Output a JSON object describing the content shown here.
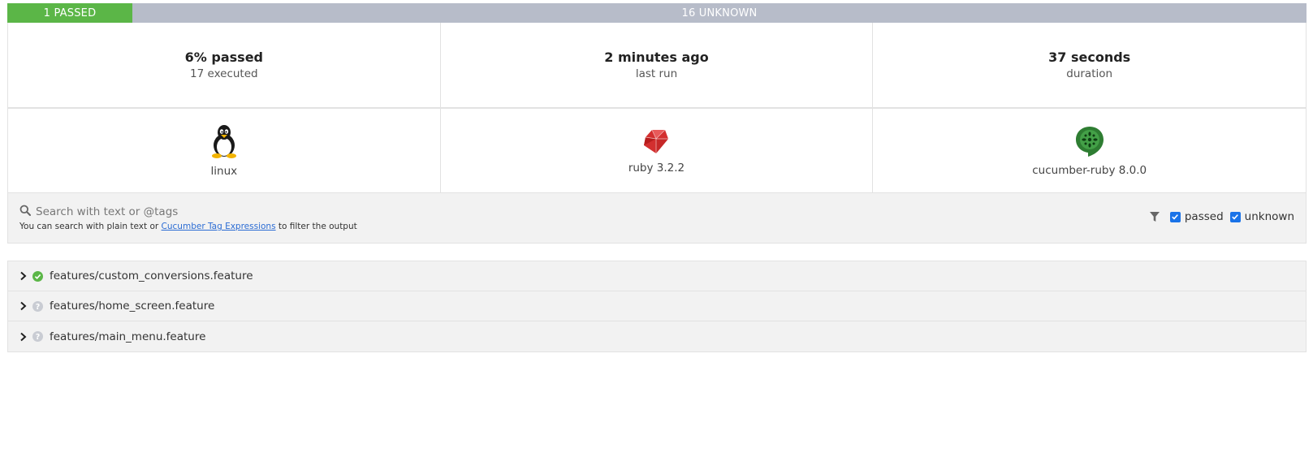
{
  "status_bar": {
    "passed_label": "1 PASSED",
    "unknown_label": "16 UNKNOWN",
    "passed_color": "#5bb647",
    "unknown_color": "#b7bcc9",
    "passed_fraction": 0.0588
  },
  "stats": [
    {
      "value": "6% passed",
      "label": "17 executed"
    },
    {
      "value": "2 minutes ago",
      "label": "last run"
    },
    {
      "value": "37 seconds",
      "label": "duration"
    }
  ],
  "environment": [
    {
      "icon": "linux-tux-icon",
      "label": "linux"
    },
    {
      "icon": "ruby-gem-icon",
      "label": "ruby 3.2.2"
    },
    {
      "icon": "cucumber-icon",
      "label": "cucumber-ruby 8.0.0"
    }
  ],
  "search": {
    "placeholder": "Search with text or @tags",
    "help_before": "You can search with plain text or ",
    "help_link": "Cucumber Tag Expressions",
    "help_after": " to filter the output"
  },
  "filters": [
    {
      "label": "passed",
      "checked": true
    },
    {
      "label": "unknown",
      "checked": true
    }
  ],
  "features": [
    {
      "name": "features/custom_conversions.feature",
      "status": "passed",
      "status_icon": "check-circle-icon"
    },
    {
      "name": "features/home_screen.feature",
      "status": "unknown",
      "status_icon": "question-circle-icon"
    },
    {
      "name": "features/main_menu.feature",
      "status": "unknown",
      "status_icon": "question-circle-icon"
    }
  ]
}
